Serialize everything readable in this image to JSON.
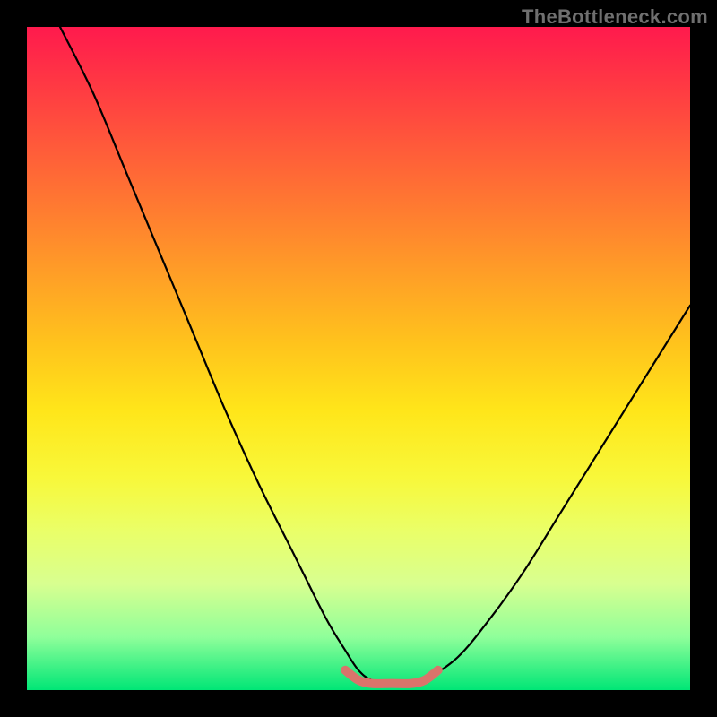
{
  "watermark": "TheBottleneck.com",
  "chart_data": {
    "type": "line",
    "title": "",
    "xlabel": "",
    "ylabel": "",
    "xlim": [
      0,
      100
    ],
    "ylim": [
      0,
      100
    ],
    "grid": false,
    "legend": false,
    "series": [
      {
        "name": "main-curve",
        "color": "#000000",
        "x": [
          5,
          10,
          15,
          20,
          25,
          30,
          35,
          40,
          45,
          48,
          50,
          52,
          55,
          58,
          60,
          65,
          70,
          75,
          80,
          85,
          90,
          95,
          100
        ],
        "y": [
          100,
          90,
          78,
          66,
          54,
          42,
          31,
          21,
          11,
          6,
          3,
          1.5,
          1,
          1,
          1.5,
          5,
          11,
          18,
          26,
          34,
          42,
          50,
          58
        ]
      },
      {
        "name": "highlight-band",
        "color": "#d9746b",
        "x": [
          48,
          50,
          52,
          55,
          58,
          60,
          62
        ],
        "y": [
          3,
          1.5,
          1,
          1,
          1,
          1.5,
          3
        ]
      }
    ]
  }
}
